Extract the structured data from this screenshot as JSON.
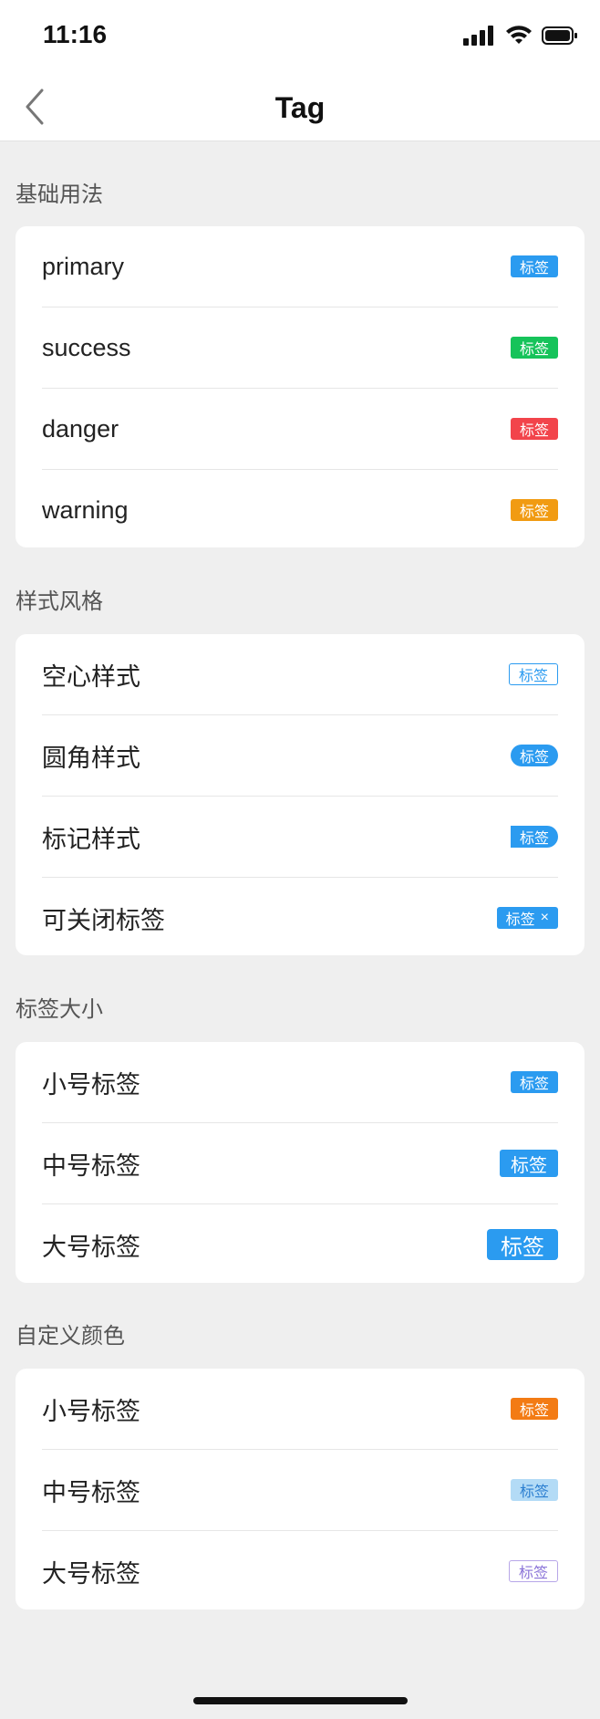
{
  "status": {
    "time": "11:16"
  },
  "nav": {
    "title": "Tag"
  },
  "sections": {
    "basic": {
      "title": "基础用法",
      "rows": [
        {
          "label": "primary",
          "tag": "标签",
          "color": "#2b9bf0"
        },
        {
          "label": "success",
          "tag": "标签",
          "color": "#16c35a"
        },
        {
          "label": "danger",
          "tag": "标签",
          "color": "#f2444b"
        },
        {
          "label": "warning",
          "tag": "标签",
          "color": "#f19b12"
        }
      ]
    },
    "style": {
      "title": "样式风格",
      "rows": [
        {
          "label": "空心样式",
          "tag": "标签"
        },
        {
          "label": "圆角样式",
          "tag": "标签"
        },
        {
          "label": "标记样式",
          "tag": "标签"
        },
        {
          "label": "可关闭标签",
          "tag": "标签",
          "close": "×"
        }
      ]
    },
    "size": {
      "title": "标签大小",
      "rows": [
        {
          "label": "小号标签",
          "tag": "标签"
        },
        {
          "label": "中号标签",
          "tag": "标签"
        },
        {
          "label": "大号标签",
          "tag": "标签"
        }
      ]
    },
    "custom": {
      "title": "自定义颜色",
      "rows": [
        {
          "label": "小号标签",
          "tag": "标签",
          "color": "#f37b14"
        },
        {
          "label": "中号标签",
          "tag": "标签",
          "color": "#b3dbf6"
        },
        {
          "label": "大号标签",
          "tag": "标签",
          "color": "#b7a6e8"
        }
      ]
    }
  }
}
